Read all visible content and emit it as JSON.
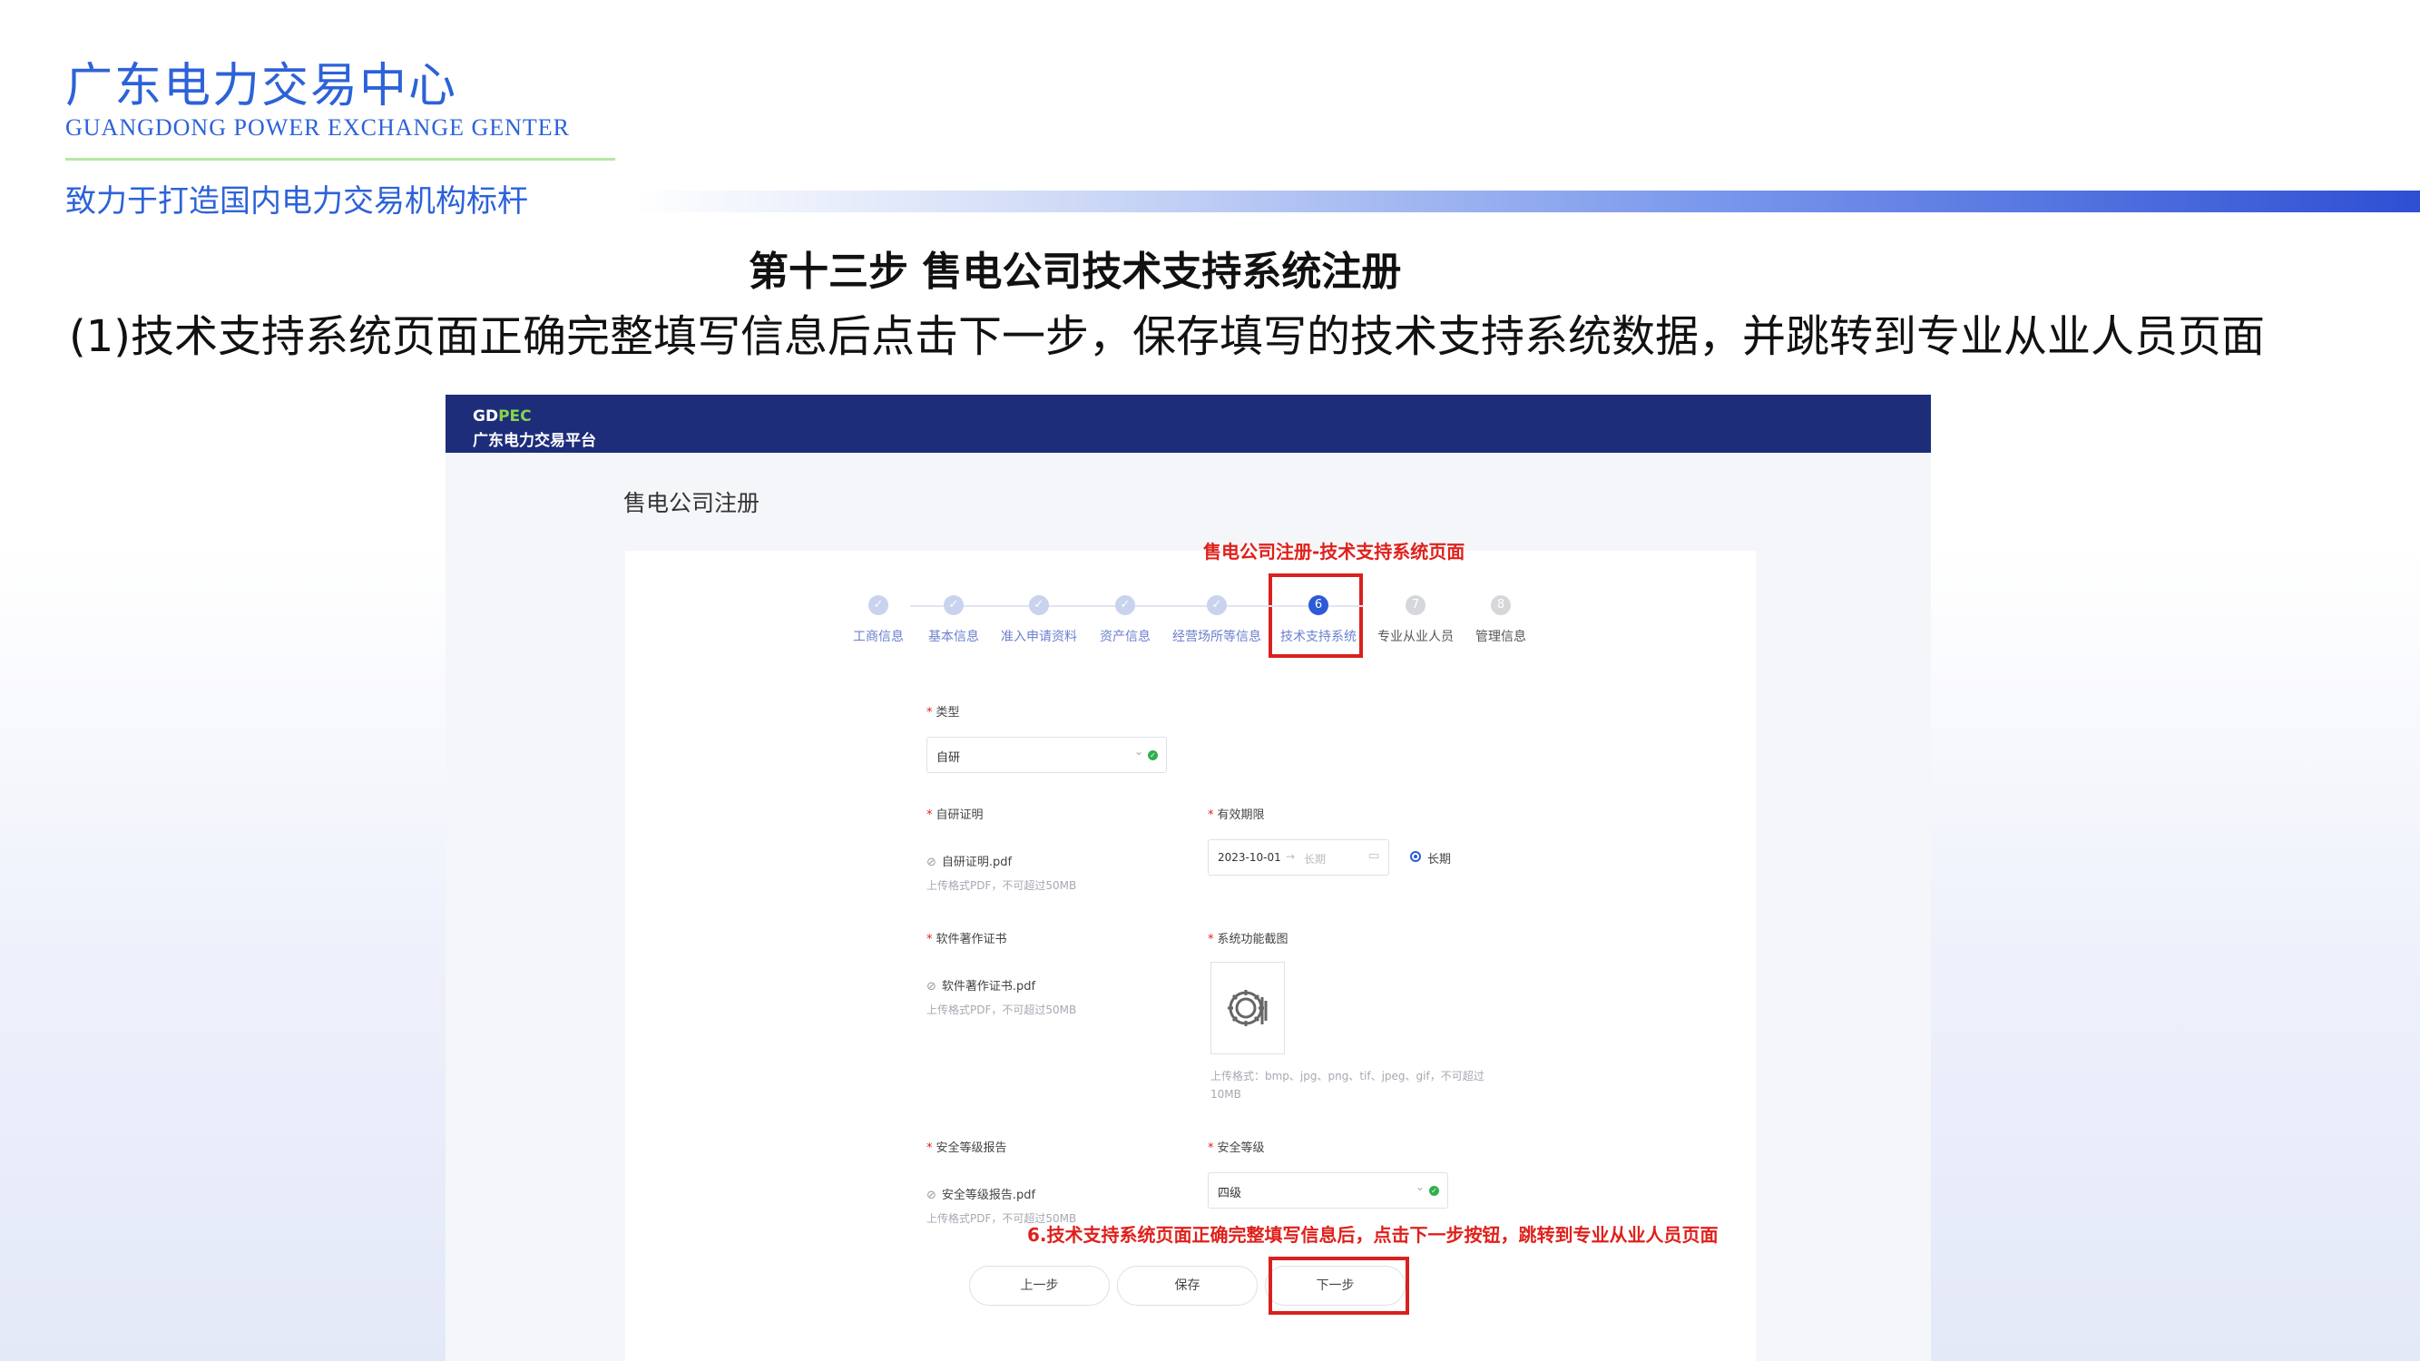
{
  "slide": {
    "org_name": "广东电力交易中心",
    "org_name_en": "GUANGDONG POWER EXCHANGE GENTER",
    "slogan": "致力于打造国内电力交易机构标杆",
    "step_title": "第十三步 售电公司技术支持系统注册",
    "description": "(1)技术支持系统页面正确完整填写信息后点击下一步，保存填写的技术支持系统数据，并跳转到专业从业人员页面"
  },
  "app": {
    "brand_prefix": "GD",
    "brand_suffix": "PEC",
    "brand_name": "广东电力交易平台",
    "page_title": "售电公司注册"
  },
  "annotations": {
    "top": "售电公司注册-技术支持系统页面",
    "bottom": "6.技术支持系统页面正确完整填写信息后，点击下一步按钮，跳转到专业从业人员页面"
  },
  "steps": [
    {
      "num": "✓",
      "label": "工商信息"
    },
    {
      "num": "✓",
      "label": "基本信息"
    },
    {
      "num": "✓",
      "label": "准入申请资料"
    },
    {
      "num": "✓",
      "label": "资产信息"
    },
    {
      "num": "✓",
      "label": "经营场所等信息"
    },
    {
      "num": "6",
      "label": "技术支持系统"
    },
    {
      "num": "7",
      "label": "专业从业人员"
    },
    {
      "num": "8",
      "label": "管理信息"
    }
  ],
  "form": {
    "type_label": "类型",
    "type_value": "自研",
    "selfdev_label": "自研证明",
    "selfdev_file": "自研证明.pdf",
    "upload_hint_pdf": "上传格式PDF，不可超过50MB",
    "validity_label": "有效期限",
    "validity_start": "2023-10-01",
    "validity_sep": "→",
    "validity_end_placeholder": "长期",
    "long_term_label": "长期",
    "copyright_label": "软件著作证书",
    "copyright_file": "软件著作证书.pdf",
    "screenshot_label": "系统功能截图",
    "screenshot_hint_1": "上传格式：bmp、jpg、png、tif、jpeg、gif，不可超过",
    "screenshot_hint_2": "10MB",
    "security_report_label": "安全等级报告",
    "security_report_file": "安全等级报告.pdf",
    "security_level_label": "安全等级",
    "security_level_value": "四级"
  },
  "buttons": {
    "prev": "上一步",
    "save": "保存",
    "next": "下一步"
  },
  "colors": {
    "brand_blue": "#2d62d8",
    "nav_dark": "#1e2d7a",
    "annotation_red": "#e0201b",
    "active_step": "#2d5bd7",
    "success_green": "#2fb04c"
  }
}
